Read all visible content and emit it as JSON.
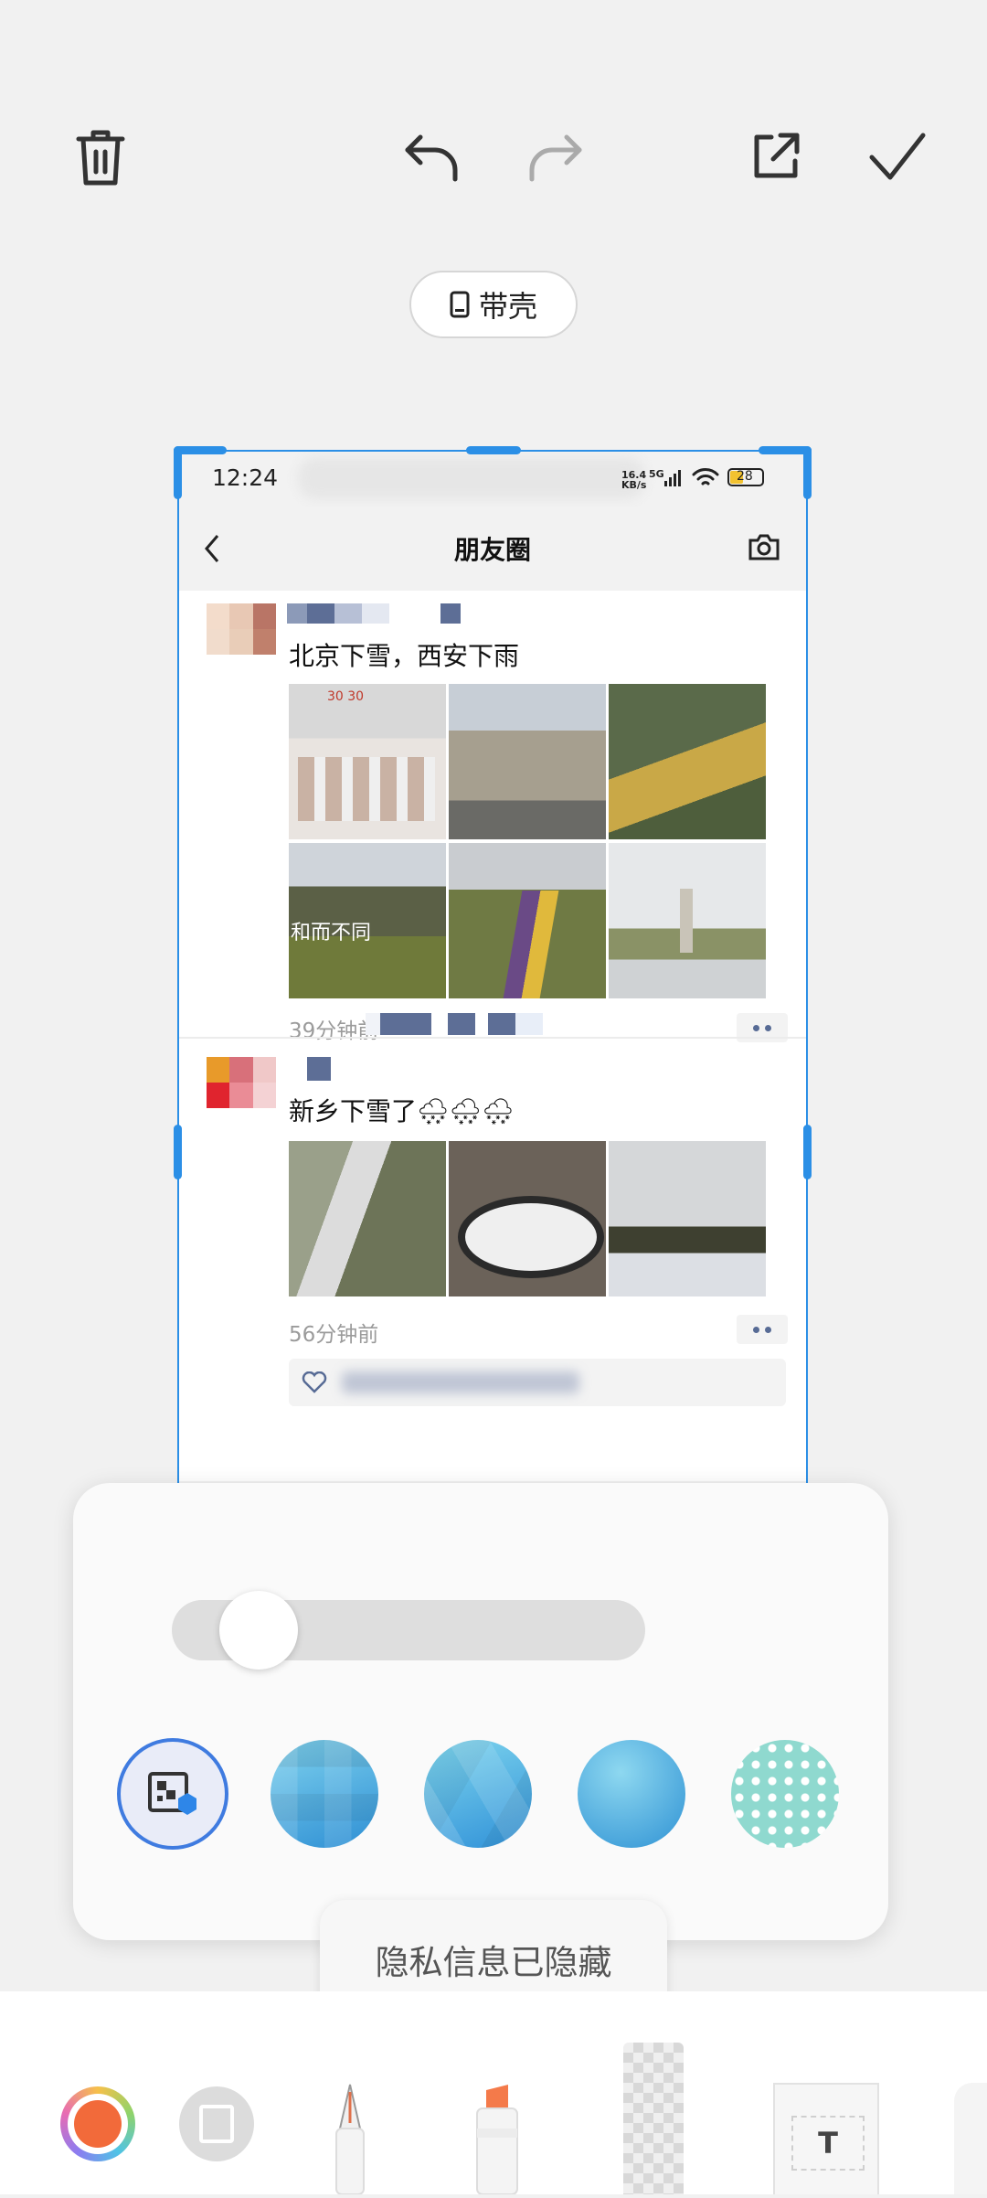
{
  "toolbar": {
    "delete": "trash-icon",
    "undo": "undo-icon",
    "redo": "redo-icon",
    "share": "share-icon",
    "done": "check-icon"
  },
  "shell_pill": {
    "label": "带壳",
    "icon": "phone-icon"
  },
  "preview": {
    "status": {
      "time": "12:24",
      "net_speed_top": "16.4",
      "net_speed_bottom": "KB/s",
      "network": "5G",
      "battery": "28"
    },
    "nav": {
      "title": "朋友圈",
      "back": "back-arrow-icon",
      "camera": "camera-icon"
    },
    "posts": [
      {
        "text": "北京下雪，西安下雨",
        "time": "39分钟前",
        "photo_count": 6
      },
      {
        "text": "新乡下雪了🌨🌨🌨",
        "time": "56分钟前",
        "photo_count": 3
      }
    ]
  },
  "mosaic_panel": {
    "brush_size_level": 0.12,
    "styles": [
      "smart-mosaic-icon",
      "pixel-mosaic",
      "triangle-mosaic",
      "blur-gradient",
      "dot-pattern"
    ],
    "selected_style": 0
  },
  "toast": {
    "message": "隐私信息已隐藏"
  },
  "bottom_tools": [
    "color-picker",
    "shape-tool",
    "pen-tool",
    "highlighter-tool",
    "mosaic-tool",
    "text-tool"
  ],
  "colors": {
    "accent": "#2b8fe6",
    "link": "#576b95",
    "pen_color": "#f26a3a"
  }
}
